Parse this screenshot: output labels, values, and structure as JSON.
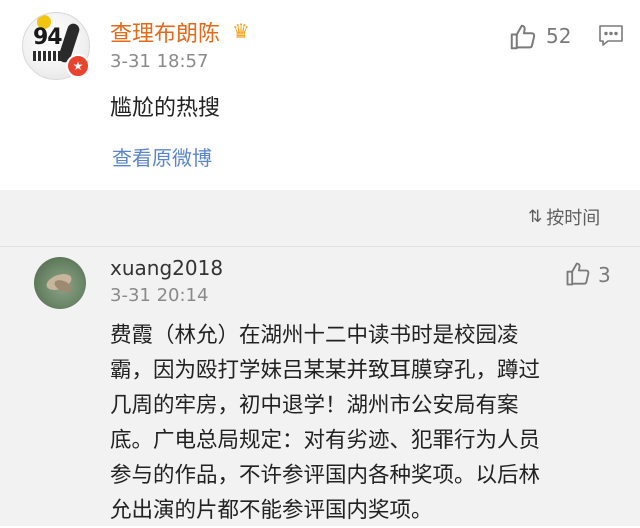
{
  "top_comment": {
    "username": "查理布朗陈",
    "time": "3-31 18:57",
    "like_count": "52",
    "text": "尴尬的热搜",
    "view_original_label": "查看原微博"
  },
  "replies_header": {
    "sort_label": "按时间"
  },
  "reply": {
    "username": "xuang2018",
    "time": "3-31 20:14",
    "like_count": "3",
    "lines": [
      "费霞（林允）在湖州十二中读书时是校园凌",
      "霸，因为殴打学妹吕某某并致耳膜穿孔，蹲过",
      "几周的牢房，初中退学！湖州市公安局有案",
      "底。广电总局规定：对有劣迹、犯罪行为人员",
      "参与的作品，不许参评国内各种奖项。以后林",
      "允出演的片都不能参评国内奖项。"
    ]
  },
  "colors": {
    "username": "#e26a1b",
    "link": "#5b86c5",
    "panel_bg": "#f2f2f2"
  }
}
